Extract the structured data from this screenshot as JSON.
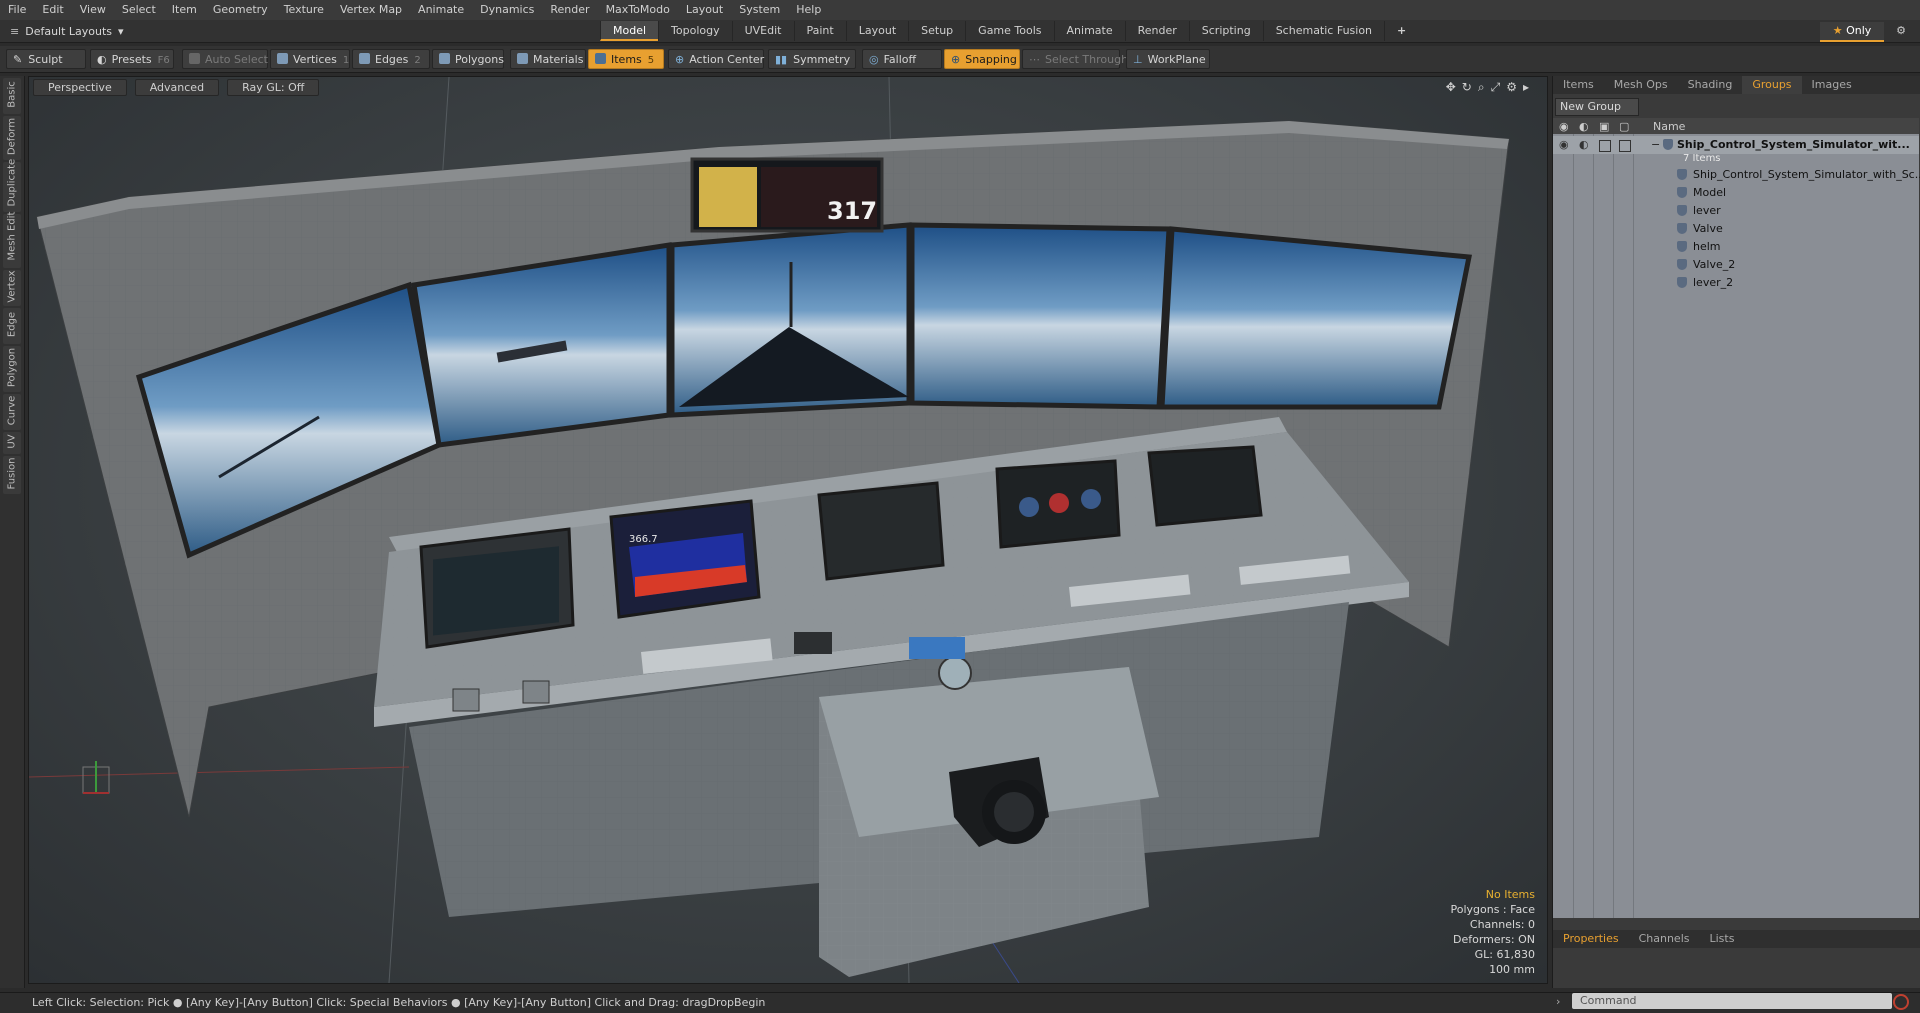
{
  "menu": [
    "File",
    "Edit",
    "View",
    "Select",
    "Item",
    "Geometry",
    "Texture",
    "Vertex Map",
    "Animate",
    "Dynamics",
    "Render",
    "MaxToModo",
    "Layout",
    "System",
    "Help"
  ],
  "layout_select": "Default Layouts",
  "top_tabs": [
    "Model",
    "Topology",
    "UVEdit",
    "Paint",
    "Layout",
    "Setup",
    "Game Tools",
    "Animate",
    "Render",
    "Scripting",
    "Schematic Fusion"
  ],
  "top_tabs_active": "Model",
  "plus_label": "+",
  "only_label": "Only",
  "toolbar": {
    "sculpt": "Sculpt",
    "presets": "Presets",
    "presets_key": "F6",
    "auto_select": "Auto Select",
    "vertices": "Vertices",
    "vertices_key": "1",
    "edges": "Edges",
    "edges_key": "2",
    "polygons": "Polygons",
    "materials": "Materials",
    "items": "Items",
    "items_key": "5",
    "action_center": "Action Center",
    "symmetry": "Symmetry",
    "falloff": "Falloff",
    "snapping": "Snapping",
    "select_through": "Select Through",
    "workplane": "WorkPlane"
  },
  "left_tabs": [
    "Basic",
    "Deform",
    "Duplicate",
    "Mesh Edit",
    "Vertex",
    "Edge",
    "Polygon",
    "Curve",
    "UV",
    "Fusion"
  ],
  "viewport": {
    "perspective": "Perspective",
    "advanced": "Advanced",
    "raygl": "Ray GL: Off",
    "monitor_readout": "317",
    "sonar_readout": "366.7"
  },
  "stats": {
    "no_items": "No Items",
    "polygons": "Polygons : Face",
    "channels": "Channels: 0",
    "deformers": "Deformers: ON",
    "gl": "GL: 61,830",
    "size": "100 mm"
  },
  "right_panel": {
    "tabs": [
      "Items",
      "Mesh Ops",
      "Shading",
      "Groups",
      "Images"
    ],
    "active_tab": "Groups",
    "new_group": "New Group",
    "name_header": "Name",
    "root_name": "Ship_Control_System_Simulator_wit...",
    "root_count": "7 Items",
    "children": [
      "Ship_Control_System_Simulator_with_Sc...",
      "Model",
      "lever",
      "Valve",
      "helm",
      "Valve_2",
      "lever_2"
    ]
  },
  "bottom_tabs": [
    "Properties",
    "Channels",
    "Lists"
  ],
  "bottom_active": "Properties",
  "status_text": "Left Click: Selection: Pick ● [Any Key]-[Any Button] Click: Special Behaviors ● [Any Key]-[Any Button] Click and Drag: dragDropBegin",
  "command_placeholder": "Command"
}
